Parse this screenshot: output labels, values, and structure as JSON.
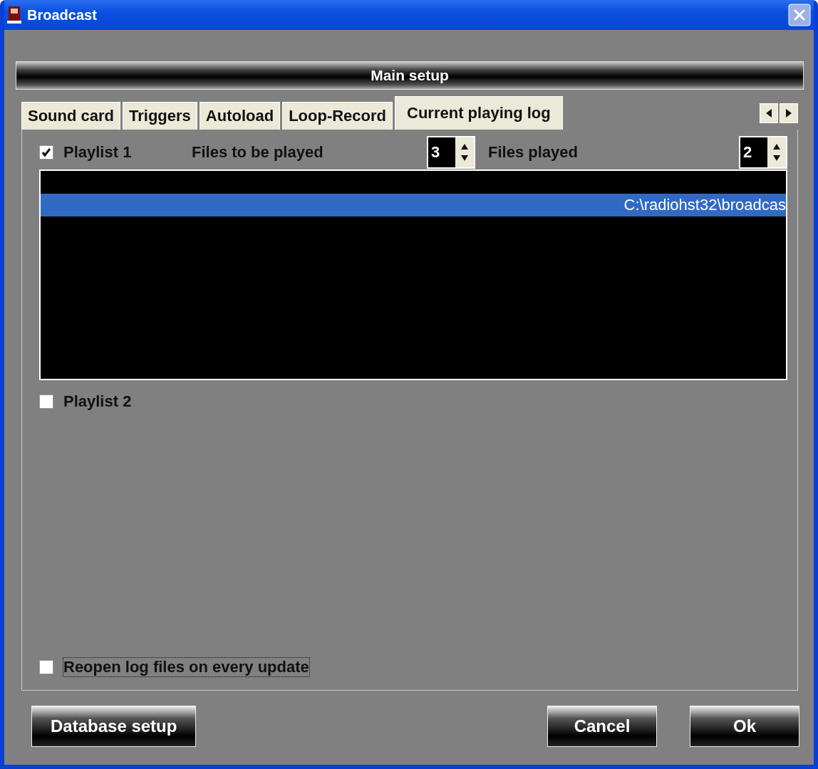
{
  "window": {
    "title": "Broadcast"
  },
  "header": "Main setup",
  "tabs": [
    {
      "label": "Sound card",
      "selected": false
    },
    {
      "label": "Triggers",
      "selected": false
    },
    {
      "label": "Autoload",
      "selected": false
    },
    {
      "label": "Loop-Record",
      "selected": false
    },
    {
      "label": "Current playing log",
      "selected": true
    }
  ],
  "playlists": [
    {
      "label": "Playlist 1",
      "checked": true,
      "files_to_play_label": "Files to be played",
      "files_to_play": "3",
      "files_played_label": "Files played",
      "files_played": "2",
      "log_rows": [
        {
          "text": "C:\\radiohst32\\broadcas",
          "selected": true
        }
      ]
    },
    {
      "label": "Playlist 2",
      "checked": false
    }
  ],
  "reopen": {
    "label": "Reopen log files on every update",
    "checked": false,
    "focused": true
  },
  "buttons": {
    "left": [
      "Database setup"
    ],
    "right": [
      "Cancel",
      "Ok"
    ]
  }
}
